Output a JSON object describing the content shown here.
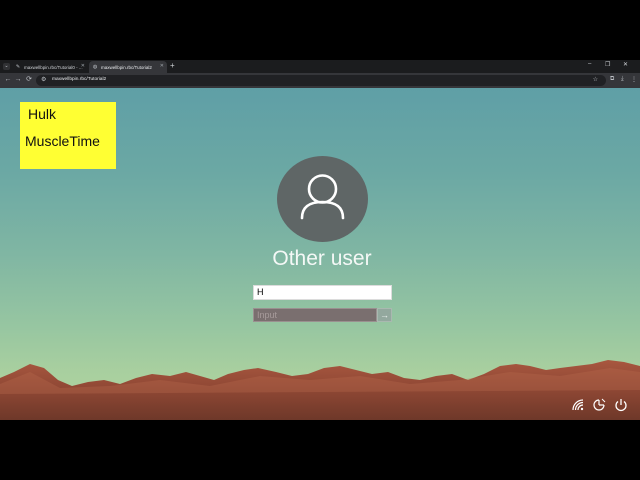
{
  "browser": {
    "tabs": [
      {
        "title": "maxwellbpin.rbc/Tutorial0 - ...",
        "active": false
      },
      {
        "title": "maxwellbpin.rbc/Tutorial2",
        "active": true
      }
    ],
    "new_tab": "+",
    "tab_list_icon": "chevron-down-icon",
    "window_controls": {
      "minimize": "–",
      "restore": "❐",
      "close": "✕"
    },
    "nav": {
      "back": "←",
      "forward": "→",
      "reload": "⟳"
    },
    "address": "maxwellbpin.rbc/Tutorial2",
    "star": "☆"
  },
  "note": {
    "line1": "Hulk",
    "line2": "MuscleTime"
  },
  "login": {
    "username": "Other user",
    "name_value": "H",
    "password_placeholder": "Input",
    "submit": "→"
  },
  "system_icons": [
    "network-icon",
    "accessibility-icon",
    "power-icon"
  ],
  "colors": {
    "note_bg": "#ffff33",
    "avatar_bg": "#5f6666",
    "password_bg": "#7a6f6f"
  }
}
